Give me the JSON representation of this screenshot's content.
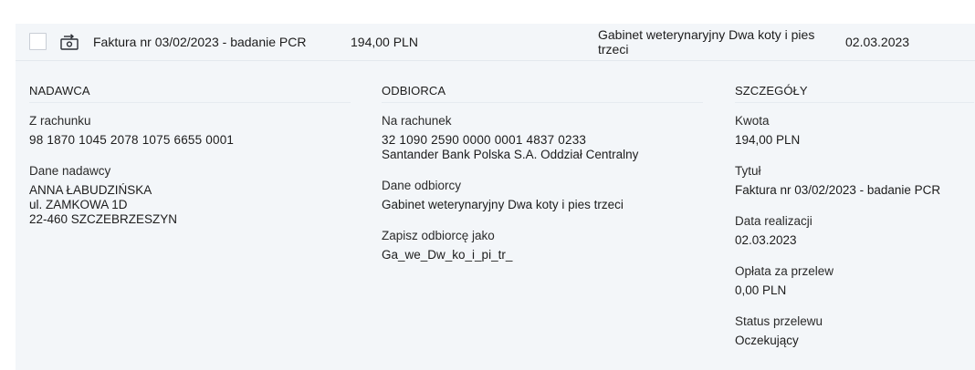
{
  "transaction": {
    "title": "Faktura nr 03/02/2023 - badanie PCR",
    "amount": "194,00 PLN",
    "payee": "Gabinet weterynaryjny Dwa koty i pies trzeci",
    "date": "02.03.2023",
    "icon": "transfer-icon"
  },
  "sender": {
    "header": "NADAWCA",
    "account_label": "Z rachunku",
    "account_number": "98 1870 1045 2078 1075 6655 0001",
    "data_label": "Dane nadawcy",
    "name": "ANNA ŁABUDZIŃSKA",
    "street": "ul. ZAMKOWA 1D",
    "city": "22-460 SZCZEBRZESZYN"
  },
  "recipient": {
    "header": "ODBIORCA",
    "account_label": "Na rachunek",
    "account_number": "32 1090 2590 0000 0001 4837 0233",
    "bank": "Santander Bank Polska S.A. Oddział Centralny",
    "data_label": "Dane odbiorcy",
    "name": "Gabinet weterynaryjny Dwa koty i pies trzeci",
    "save_label": "Zapisz odbiorcę jako",
    "save_value": "Ga_we_Dw_ko_i_pi_tr_"
  },
  "details": {
    "header": "SZCZEGÓŁY",
    "amount_label": "Kwota",
    "amount_value": "194,00 PLN",
    "title_label": "Tytuł",
    "title_value": "Faktura nr 03/02/2023 - badanie PCR",
    "date_label": "Data realizacji",
    "date_value": "02.03.2023",
    "fee_label": "Opłata za przelew",
    "fee_value": "0,00 PLN",
    "status_label": "Status przelewu",
    "status_value": "Oczekujący"
  }
}
